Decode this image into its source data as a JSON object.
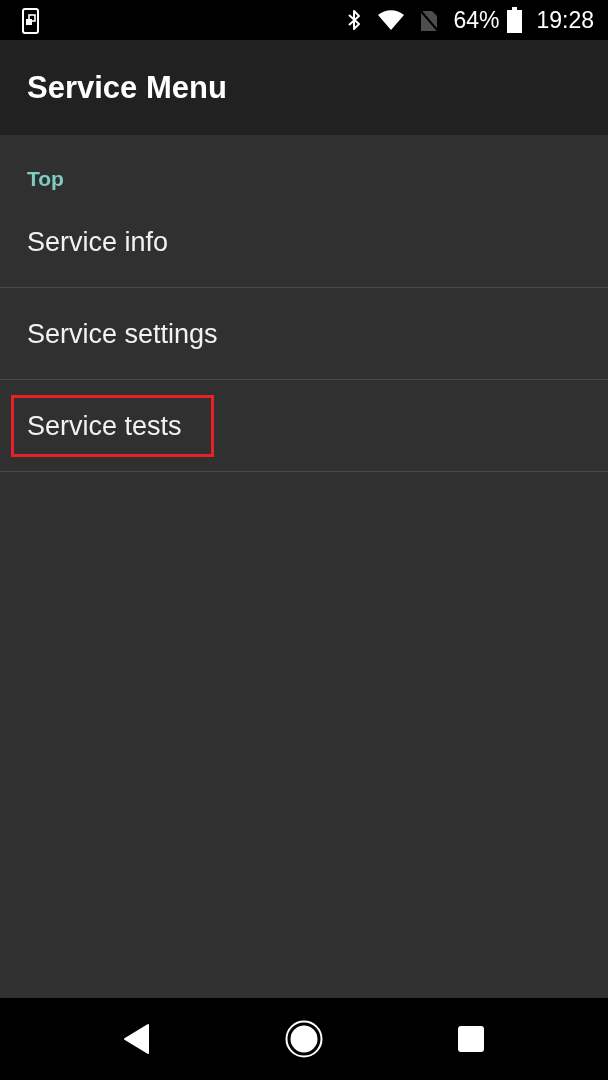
{
  "status_bar": {
    "battery_percent": "64%",
    "time": "19:28"
  },
  "app_bar": {
    "title": "Service Menu"
  },
  "menu": {
    "category": "Top",
    "items": [
      {
        "label": "Service info",
        "highlighted": false
      },
      {
        "label": "Service settings",
        "highlighted": false
      },
      {
        "label": "Service tests",
        "highlighted": true
      }
    ]
  }
}
